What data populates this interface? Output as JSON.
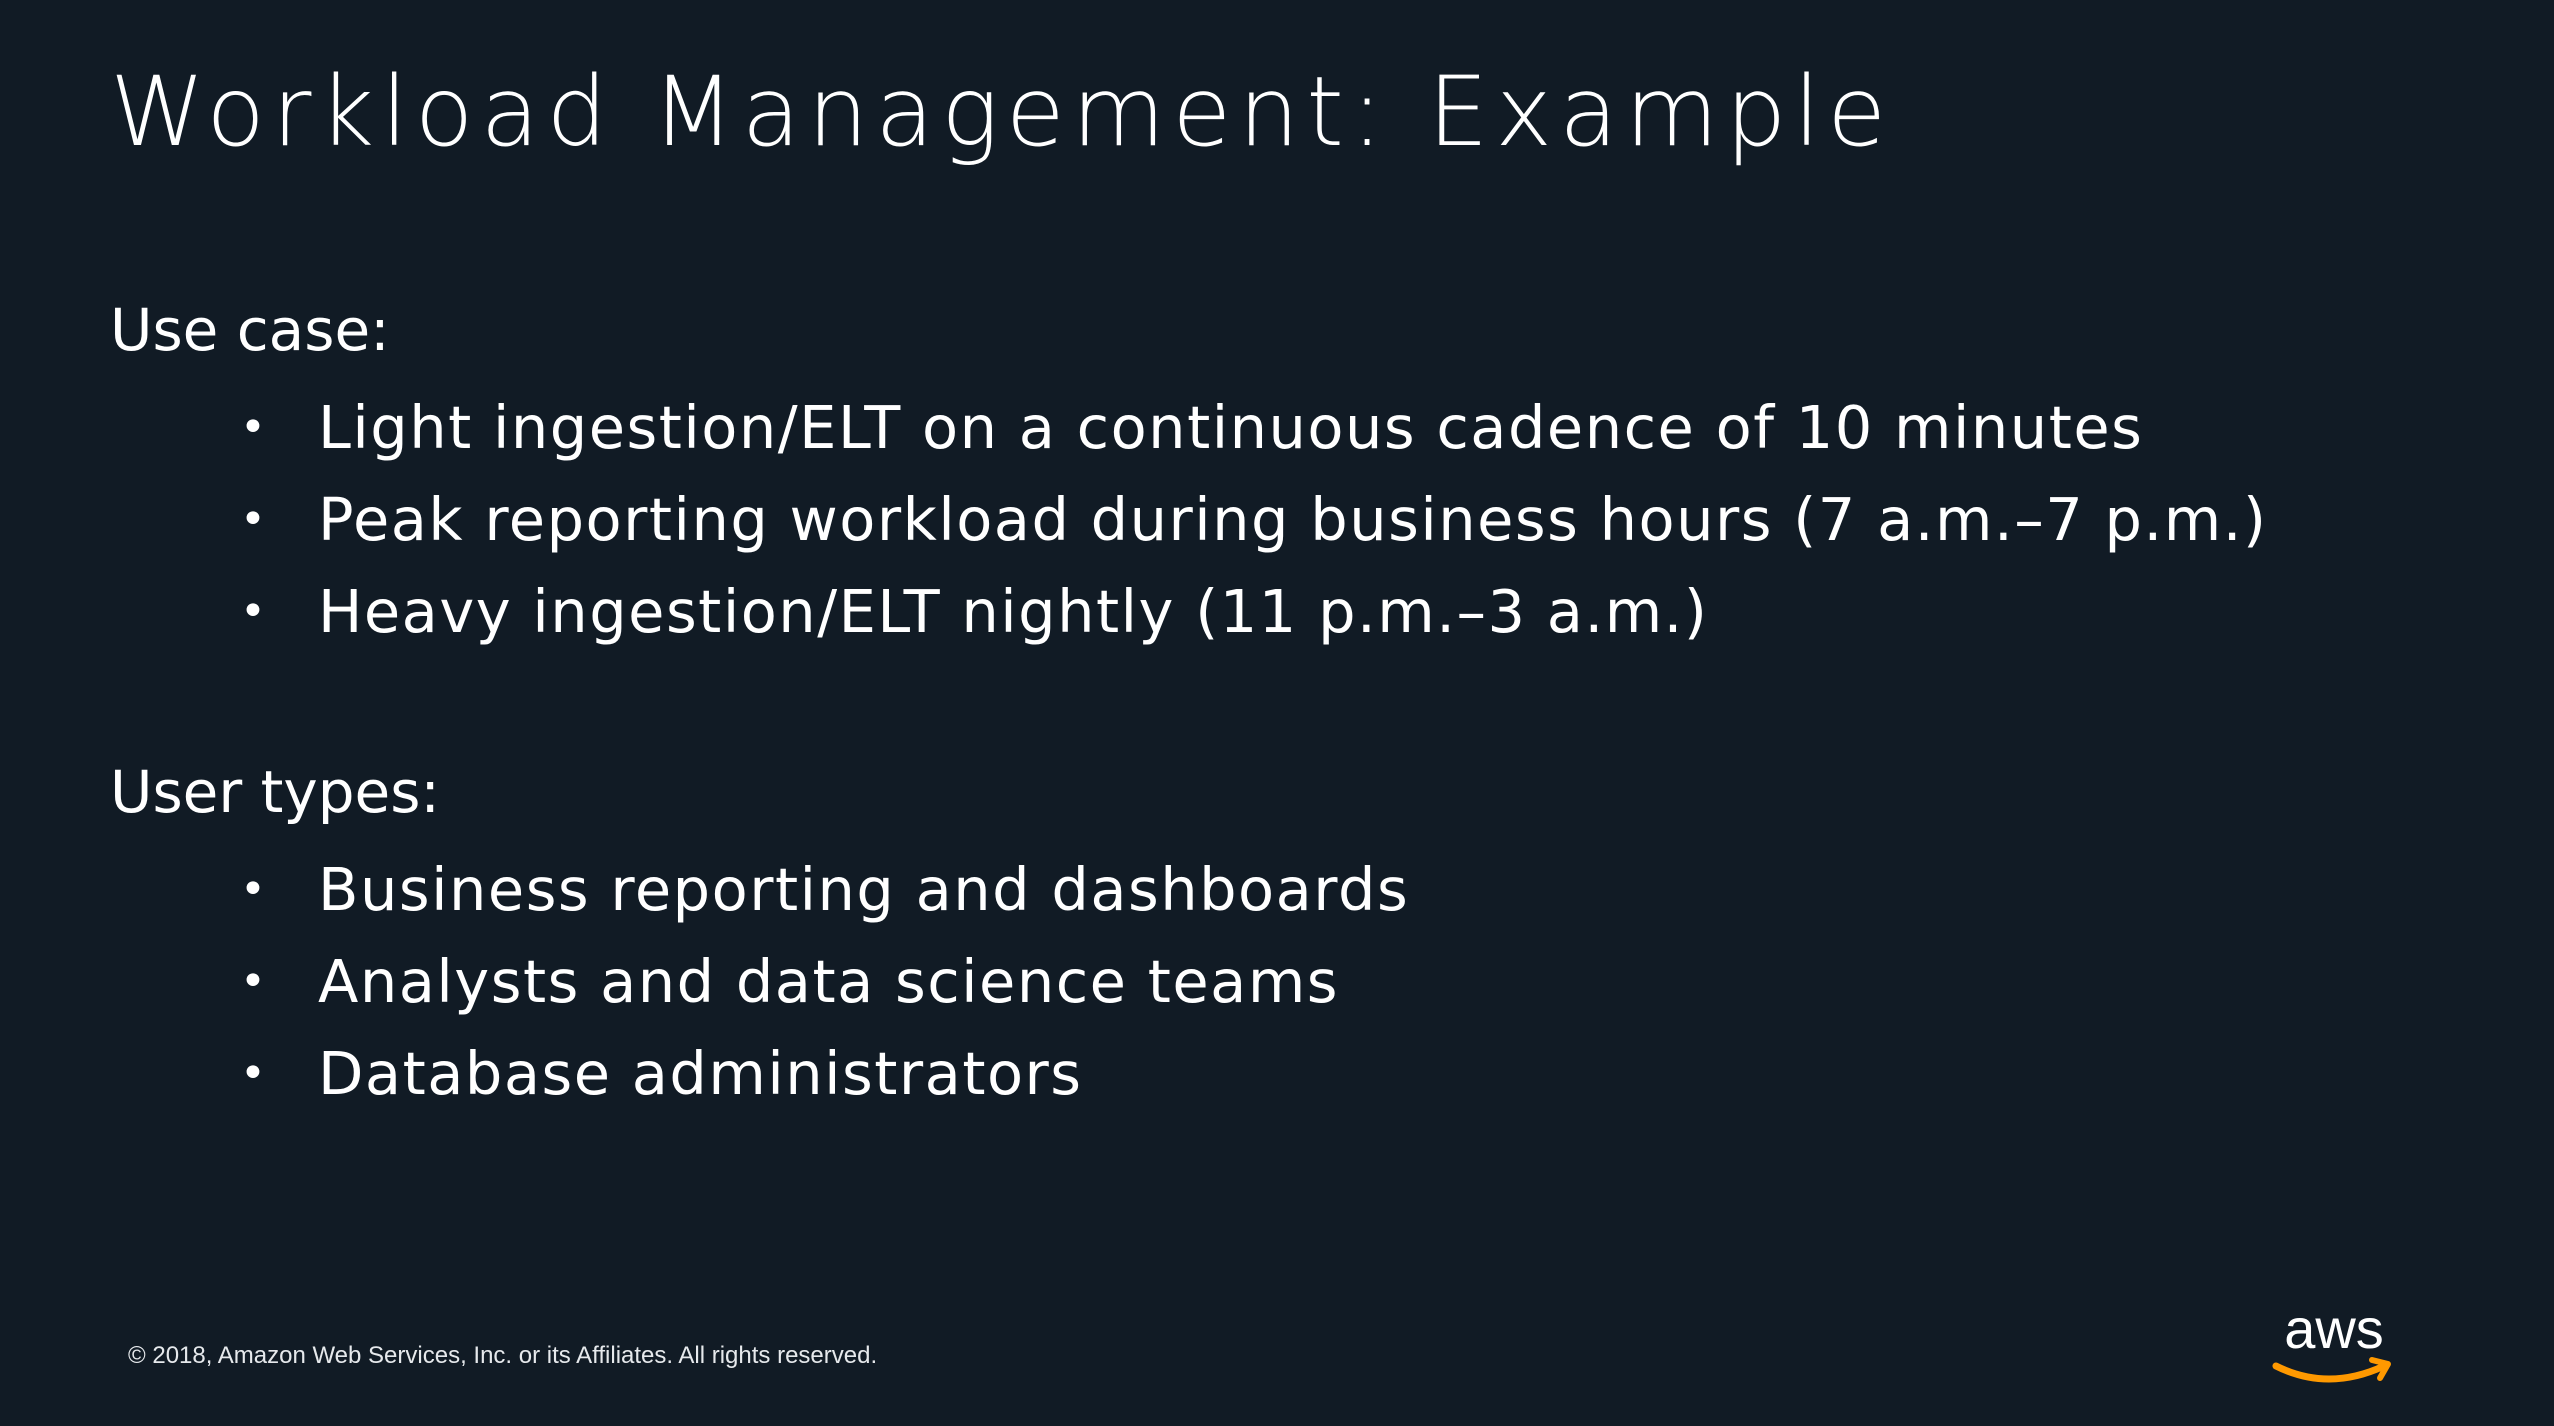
{
  "slide": {
    "title": "Workload Management: Example",
    "sections": [
      {
        "heading": "Use case:",
        "bullets": [
          "Light ingestion/ELT on a continuous cadence of 10 minutes",
          "Peak reporting workload during business hours (7 a.m.–7 p.m.)",
          "Heavy ingestion/ELT nightly (11 p.m.–3 a.m.)"
        ]
      },
      {
        "heading": "User types:",
        "bullets": [
          "Business reporting and dashboards",
          "Analysts and data science teams",
          "Database administrators"
        ]
      }
    ],
    "bullet_glyph": "•",
    "footer": "© 2018, Amazon Web Services, Inc. or its Affiliates. All rights reserved.",
    "logo": {
      "text": "aws",
      "icon": "aws-logo",
      "smile_color": "#ff9900"
    },
    "colors": {
      "background": "#111b25",
      "text": "#ffffff",
      "accent": "#ff9900"
    }
  }
}
